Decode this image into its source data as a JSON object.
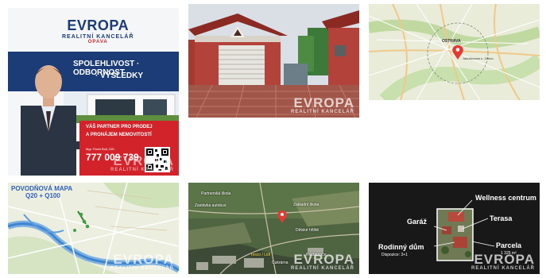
{
  "watermark": {
    "brand": "EVROPA",
    "sub": "REALITNÍ KANCELÁŘ"
  },
  "tile1": {
    "logo_brand": "EVROPA",
    "logo_sub": "REALITNÍ KANCELÁŘ",
    "logo_city": "OPAVA",
    "banner_line1": "SPOLEHLIVOST · ODBORNOST",
    "banner_line2": "· VÝSLEDKY",
    "red_line1": "VÁŠ PARTNER PRO PRODEJ",
    "red_line2": "A PRONÁJEM NEMOVITOSTÍ",
    "agent_name": "Mgr. Pavel Bolt, DiS.",
    "phone": "777 009 739"
  },
  "tile3": {
    "map_place": "OSTRAVA",
    "map_sub": "Jakubčovice n. Odrou"
  },
  "tile4": {
    "title_line1": "POVODŇOVÁ MAPA",
    "title_line2": "Q20 + Q100"
  },
  "tile5": {
    "labels": [
      "Partnerská škola",
      "Zastávka autobus",
      "Základní škola",
      "Dětské hřiště",
      "Tesco / Lidl",
      "Cukrárna",
      "Restaurace"
    ]
  },
  "tile6": {
    "wellness": "Wellness centrum",
    "garage": "Garáž",
    "terrace": "Terasa",
    "house": "Rodinný dům",
    "layout": "Dispozice: 3+1",
    "plot": "Parcela",
    "plot_area": "1 325 m²"
  }
}
